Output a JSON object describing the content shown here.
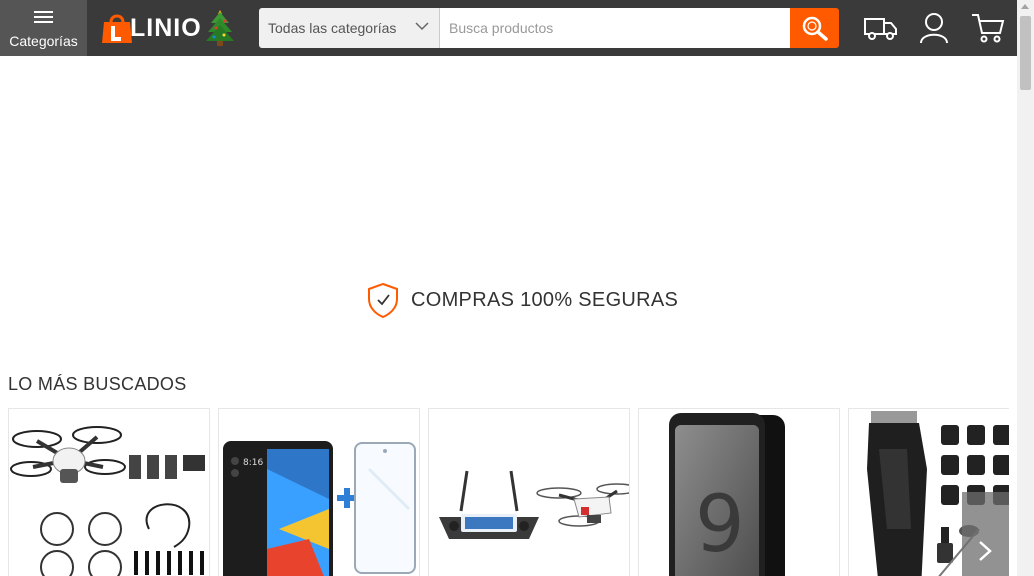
{
  "header": {
    "categories_label": "Categorías",
    "logo_text": "LINIO",
    "category_select": "Todas las categorías",
    "search_placeholder": "Busca productos",
    "icons": [
      "truck-icon",
      "user-icon",
      "cart-icon"
    ]
  },
  "trust": {
    "label": "COMPRAS 100% SEGURAS"
  },
  "most_searched": {
    "title": "LO MÁS BUSCADOS",
    "products": [
      {
        "image": "drone-kit-image"
      },
      {
        "image": "smartphone-with-screen-protector-image"
      },
      {
        "image": "drone-with-controller-image"
      },
      {
        "image": "galaxy-s9-phone-image"
      },
      {
        "image": "hair-clipper-kit-image"
      }
    ]
  },
  "colors": {
    "header_bg": "#3a3a3a",
    "accent": "#ff5a00"
  }
}
